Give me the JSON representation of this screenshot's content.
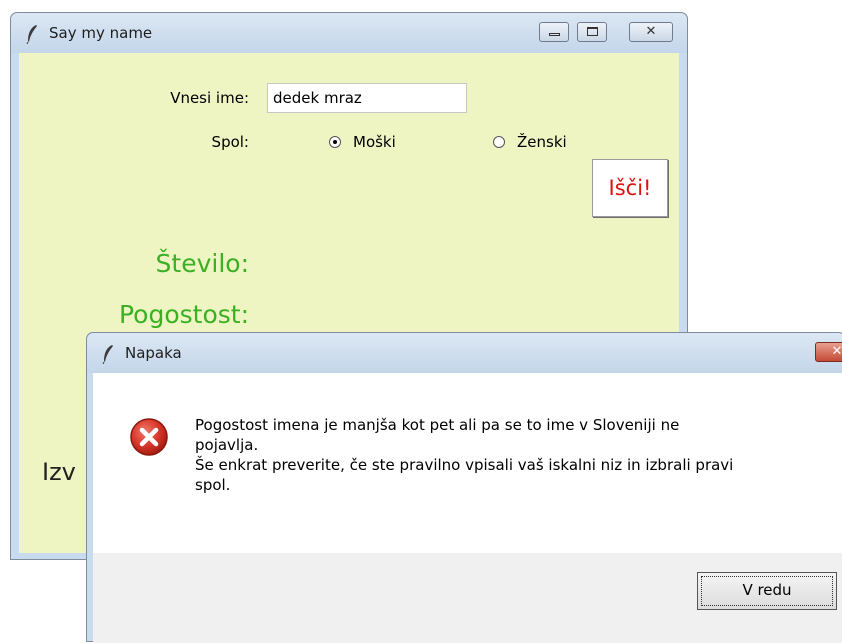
{
  "main_window": {
    "title": "Say my name",
    "name_label": "Vnesi ime:",
    "name_value": "dedek mraz",
    "gender_label": "Spol:",
    "radio_male": "Moški",
    "radio_female": "Ženski",
    "selected_gender": "Moški",
    "search_button": "Išči!",
    "count_label": "Število:",
    "frequency_label": "Pogostost:",
    "partial_label": "Izv",
    "colors": {
      "background": "#eef5c3",
      "green_labels": "#3bb023",
      "search_text": "#e01010"
    }
  },
  "dialog": {
    "title": "Napaka",
    "message_lines": [
      "Pogostost imena je manjša kot pet ali pa se to ime v Sloveniji ne",
      "pojavlja.",
      "Še enkrat preverite, če ste pravilno vpisali vaš iskalni niz in izbrali pravi",
      "spol."
    ],
    "ok_button": "V redu",
    "icon": "error-icon"
  }
}
